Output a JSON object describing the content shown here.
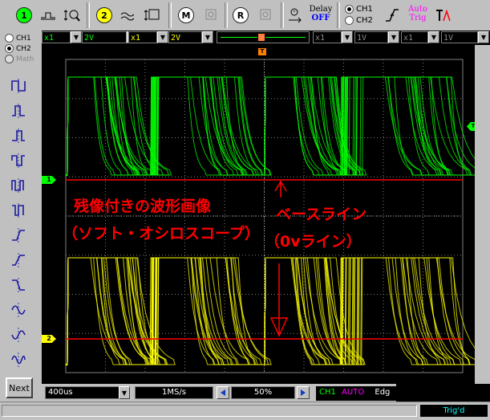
{
  "toolbar": {
    "ch1_button": "1",
    "ch2_button": "2",
    "measure_button": "M",
    "ref_button": "R",
    "delay_label": "Delay",
    "delay_state": "OFF",
    "trig_source_ch1": "CH1",
    "trig_source_ch2": "CH2",
    "auto_trig_line1": "Auto",
    "auto_trig_line2": "Trig"
  },
  "channel_panel": {
    "ch1": "CH1",
    "ch2": "CH2",
    "math": "Math"
  },
  "controls": {
    "ch1_probe": "x1",
    "ch1_volts": "2V",
    "ch2_probe": "x1",
    "ch2_volts": "2V",
    "math_probe_a": "x1",
    "math_volts_a": "1V",
    "math_probe_b": "x1",
    "math_volts_b": "1V"
  },
  "markers": {
    "trigger_position": "T",
    "trigger_level": "T",
    "ch1_ground": "1",
    "ch2_ground": "2"
  },
  "annotations": {
    "title_line1": "残像付きの波形画像",
    "title_line2": "（ソフト・オシロスコープ）",
    "baseline_line1": "ベースライン",
    "baseline_line2": "（0vライン）"
  },
  "bottom": {
    "timebase": "400us",
    "sample_rate": "1MS/s",
    "position": "50%",
    "trig_channel": "CH1",
    "trig_mode": "AUTO",
    "trig_edge": "Edg"
  },
  "left_buttons": {
    "next": "Next"
  },
  "status": {
    "trigd": "Trig'd"
  },
  "colors": {
    "ch1": "#00ff00",
    "ch2": "#ffff00",
    "annotation": "#ff0000",
    "baseline": "#ff0000",
    "grid": "#808080",
    "math_text": "#ff00ff"
  }
}
